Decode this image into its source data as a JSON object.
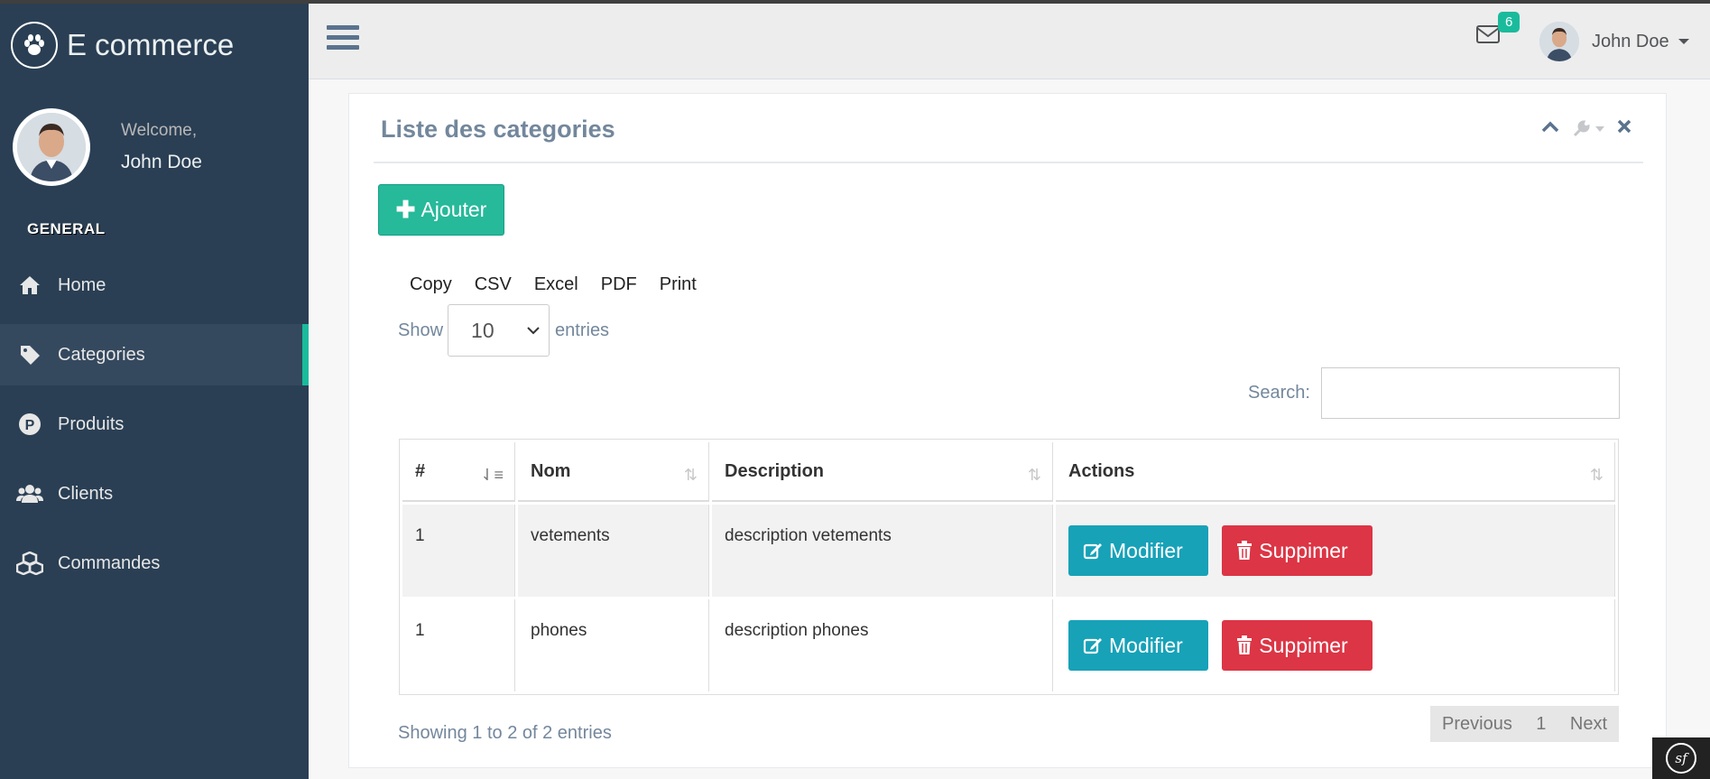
{
  "brand": {
    "title": "E commerce",
    "logo_icon": "paw-icon"
  },
  "profile": {
    "welcome": "Welcome,",
    "name": "John Doe"
  },
  "sidebar": {
    "section": "GENERAL",
    "items": [
      {
        "label": "Home",
        "icon": "home-icon",
        "active": false
      },
      {
        "label": "Categories",
        "icon": "tag-icon",
        "active": true
      },
      {
        "label": "Produits",
        "icon": "parking-icon",
        "active": false
      },
      {
        "label": "Clients",
        "icon": "users-icon",
        "active": false
      },
      {
        "label": "Commandes",
        "icon": "cubes-icon",
        "active": false
      }
    ]
  },
  "topnav": {
    "mail_count": "6",
    "user_name": "John Doe"
  },
  "panel": {
    "title": "Liste des categories"
  },
  "toolbar": {
    "add_label": "Ajouter"
  },
  "export": {
    "copy": "Copy",
    "csv": "CSV",
    "excel": "Excel",
    "pdf": "PDF",
    "print": "Print"
  },
  "length": {
    "show": "Show",
    "value": "10",
    "entries": "entries"
  },
  "search": {
    "label": "Search:",
    "value": ""
  },
  "table": {
    "headers": [
      "#",
      "Nom",
      "Description",
      "Actions"
    ],
    "rows": [
      {
        "id": "1",
        "nom": "vetements",
        "description": "description vetements"
      },
      {
        "id": "1",
        "nom": "phones",
        "description": "description phones"
      }
    ],
    "edit_label": "Modifier",
    "delete_label": "Suppimer"
  },
  "footer": {
    "info": "Showing 1 to 2 of 2 entries",
    "previous": "Previous",
    "page": "1",
    "next": "Next"
  },
  "colors": {
    "sidebar": "#2A3F54",
    "accent": "#1ABB9C",
    "success": "#26B99A",
    "info": "#17A2B8",
    "danger": "#DC3545"
  }
}
